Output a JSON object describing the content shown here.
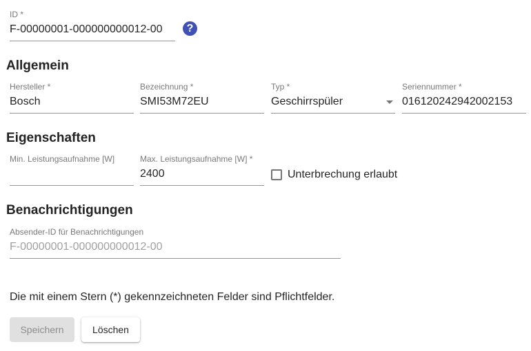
{
  "id_field": {
    "label": "ID *",
    "value": "F-00000001-000000000012-00",
    "help_icon": "help-icon",
    "help_glyph": "?",
    "accent_color": "#3f51b5"
  },
  "sections": {
    "general": "Allgemein",
    "properties": "Eigenschaften",
    "notifications": "Benachrichtigungen"
  },
  "general": {
    "manufacturer": {
      "label": "Hersteller *",
      "value": "Bosch"
    },
    "designation": {
      "label": "Bezeichnung *",
      "value": "SMI53M72EU"
    },
    "type": {
      "label": "Typ *",
      "value": "Geschirrspüler",
      "icon": "dropdown-arrow-icon"
    },
    "serial": {
      "label": "Seriennummer *",
      "value": "016120242942002153"
    }
  },
  "properties": {
    "min_power": {
      "label": "Min. Leistungsaufnahme [W]",
      "value": ""
    },
    "max_power": {
      "label": "Max. Leistungsaufnahme [W] *",
      "value": "2400"
    },
    "interruption": {
      "label": "Unterbrechung erlaubt",
      "checked": false
    }
  },
  "notifications": {
    "sender_id": {
      "label": "Absender-ID für Benachrichtigungen",
      "value": "F-00000001-000000000012-00"
    }
  },
  "footer": {
    "required_note": "Die mit einem Stern (*) gekennzeichneten Felder sind Pflichtfelder.",
    "save_label": "Speichern",
    "delete_label": "Löschen"
  }
}
